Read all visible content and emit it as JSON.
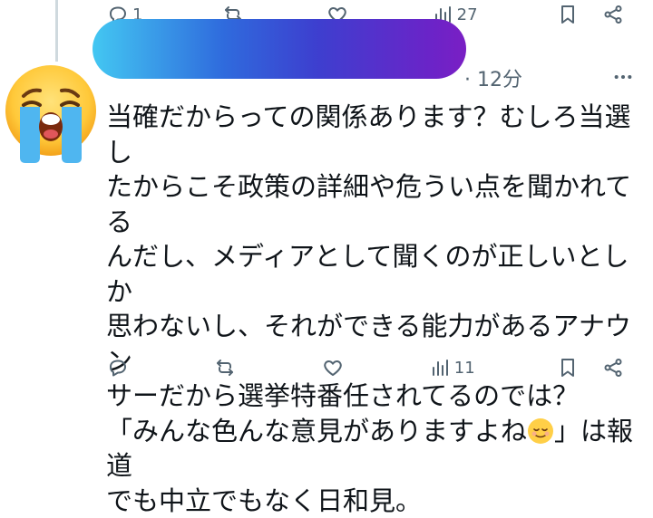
{
  "tweet_top": {
    "reply_count": "1",
    "retweet_count": "",
    "like_count": "",
    "view_count": "27"
  },
  "reply": {
    "timestamp": "· 12分",
    "text_lines": [
      "当確だからっての関係あります？むしろ当選し",
      "たからこそ政策の詳細や危うい点を聞かれてる",
      "んだし、メディアとして聞くのが正しいとしか",
      "思わないし、それができる能力があるアナウン",
      "サーだから選挙特番任されてるのでは？",
      "「みんな色んな意見がありますよね",
      "」は報道",
      "でも中立でもなく日和見。"
    ],
    "reply_count": "",
    "retweet_count": "",
    "like_count": "",
    "view_count": "11"
  },
  "icons": {
    "reply": "reply-icon",
    "retweet": "retweet-icon",
    "like": "heart-icon",
    "views": "views-icon",
    "bookmark": "bookmark-icon",
    "share": "share-icon",
    "more": "more-icon",
    "avatar": "crying-face-emoji",
    "inline_emoji": "relieved-face-emoji"
  },
  "colors": {
    "text": "#0f1419",
    "muted": "#536471",
    "redaction_start": "#43c7f2",
    "redaction_end": "#7a1fc4"
  }
}
